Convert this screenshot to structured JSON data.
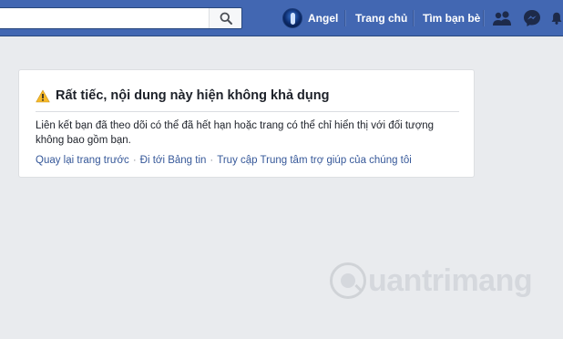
{
  "topbar": {
    "search": {
      "value": "",
      "placeholder": ""
    },
    "user_name": "Angel",
    "home_label": "Trang chủ",
    "find_friends_label": "Tìm bạn bè",
    "icons": [
      "search-icon",
      "friend-requests-icon",
      "messenger-icon",
      "notifications-icon"
    ]
  },
  "error_card": {
    "title": "Rất tiếc, nội dung này hiện không khả dụng",
    "message": "Liên kết bạn đã theo dõi có thể đã hết hạn hoặc trang có thể chỉ hiển thị với đối tượng không bao gồm bạn.",
    "links": [
      {
        "label": "Quay lại trang trước"
      },
      {
        "label": "Đi tới Bảng tin"
      },
      {
        "label": "Truy cập Trung tâm trợ giúp của chúng tôi"
      }
    ],
    "separator": "·"
  },
  "watermark": {
    "text": "uantrimang"
  },
  "colors": {
    "brand_blue": "#4267b2",
    "page_background": "#e9ebee",
    "link": "#365899",
    "warning": "#f7b928"
  }
}
